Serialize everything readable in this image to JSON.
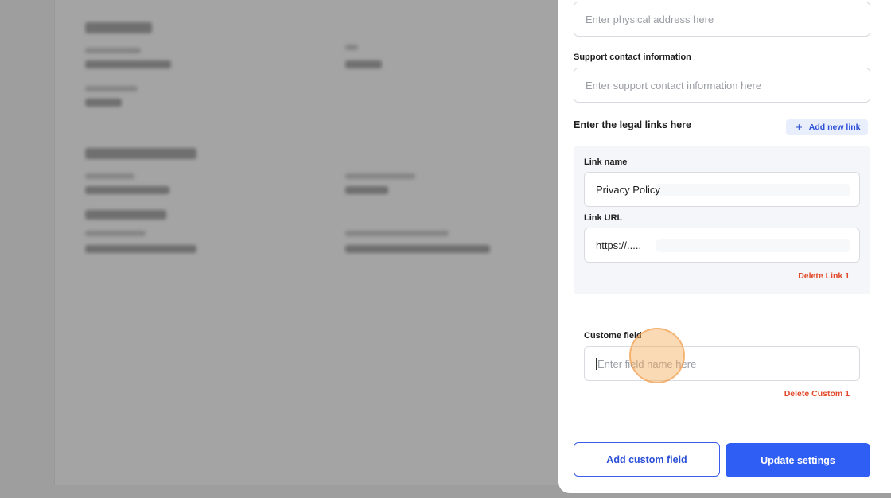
{
  "form": {
    "address_placeholder": "Enter physical address here",
    "support_label": "Support contact information",
    "support_placeholder": "Enter support contact information here",
    "legal_links_title": "Enter the legal links here",
    "add_link_label": "Add new link",
    "links": [
      {
        "name_label": "Link name",
        "name_value": "Privacy Policy",
        "url_label": "Link URL",
        "url_value": "https://.....",
        "delete_label": "Delete Link 1"
      }
    ],
    "custom_fields": [
      {
        "label": "Custome field",
        "placeholder": "Enter field name here",
        "delete_label": "Delete Custom 1"
      }
    ],
    "add_custom_field_label": "Add custom field",
    "update_settings_label": "Update settings"
  },
  "colors": {
    "primary": "#2f5ef5",
    "danger": "#e24a2b",
    "overlay": "#9e9e9e"
  }
}
